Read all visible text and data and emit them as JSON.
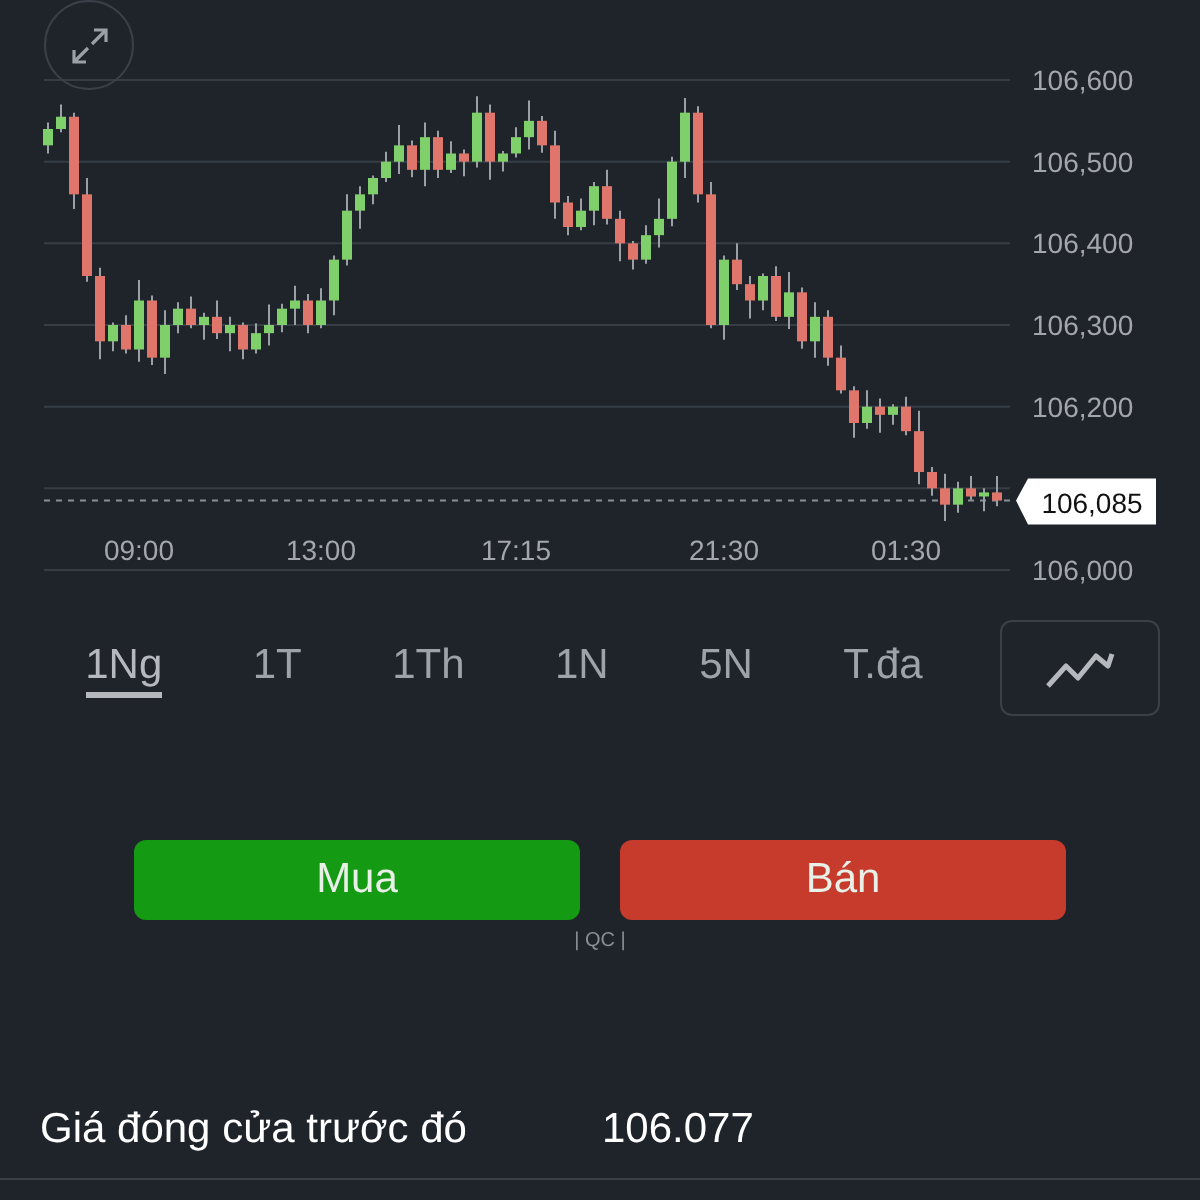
{
  "chart": {
    "chart_data": {
      "type": "candlestick",
      "categories": [
        null,
        null,
        null,
        null,
        null,
        null,
        null,
        "09:00",
        null,
        null,
        null,
        null,
        null,
        null,
        null,
        null,
        null,
        null,
        null,
        null,
        null,
        "13:00",
        null,
        null,
        null,
        null,
        null,
        null,
        null,
        null,
        null,
        null,
        null,
        null,
        null,
        null,
        "17:15",
        null,
        null,
        null,
        null,
        null,
        null,
        null,
        null,
        null,
        null,
        null,
        null,
        null,
        null,
        null,
        "21:30",
        null,
        null,
        null,
        null,
        null,
        null,
        null,
        null,
        null,
        null,
        null,
        null,
        null,
        "01:30",
        null,
        null,
        null,
        null,
        null,
        null,
        null
      ],
      "ohlc": [
        [
          106520,
          106548,
          106510,
          106540
        ],
        [
          106540,
          106570,
          106536,
          106555
        ],
        [
          106555,
          106560,
          106442,
          106460
        ],
        [
          106460,
          106480,
          106353,
          106360
        ],
        [
          106360,
          106370,
          106258,
          106280
        ],
        [
          106280,
          106303,
          106268,
          106300
        ],
        [
          106300,
          106312,
          106265,
          106270
        ],
        [
          106270,
          106355,
          106255,
          106330
        ],
        [
          106330,
          106336,
          106251,
          106260
        ],
        [
          106260,
          106318,
          106240,
          106300
        ],
        [
          106300,
          106328,
          106290,
          106320
        ],
        [
          106320,
          106335,
          106296,
          106300
        ],
        [
          106300,
          106315,
          106282,
          106310
        ],
        [
          106310,
          106330,
          106283,
          106290
        ],
        [
          106290,
          106310,
          106268,
          106300
        ],
        [
          106300,
          106303,
          106258,
          106270
        ],
        [
          106270,
          106302,
          106265,
          106290
        ],
        [
          106290,
          106325,
          106275,
          106300
        ],
        [
          106300,
          106326,
          106291,
          106320
        ],
        [
          106320,
          106348,
          106300,
          106330
        ],
        [
          106330,
          106338,
          106290,
          106300
        ],
        [
          106300,
          106345,
          106296,
          106330
        ],
        [
          106330,
          106385,
          106312,
          106380
        ],
        [
          106380,
          106460,
          106373,
          106440
        ],
        [
          106440,
          106470,
          106418,
          106460
        ],
        [
          106460,
          106483,
          106448,
          106480
        ],
        [
          106480,
          106512,
          106475,
          106500
        ],
        [
          106500,
          106545,
          106485,
          106520
        ],
        [
          106520,
          106526,
          106481,
          106490
        ],
        [
          106490,
          106548,
          106470,
          106530
        ],
        [
          106530,
          106538,
          106480,
          106490
        ],
        [
          106490,
          106525,
          106486,
          106510
        ],
        [
          106510,
          106515,
          106482,
          106500
        ],
        [
          106500,
          106580,
          106493,
          106560
        ],
        [
          106560,
          106570,
          106478,
          106500
        ],
        [
          106500,
          106513,
          106488,
          106510
        ],
        [
          106510,
          106542,
          106505,
          106530
        ],
        [
          106530,
          106575,
          106515,
          106550
        ],
        [
          106550,
          106556,
          106511,
          106520
        ],
        [
          106520,
          106538,
          106430,
          106450
        ],
        [
          106450,
          106458,
          106410,
          106420
        ],
        [
          106420,
          106455,
          106416,
          106440
        ],
        [
          106440,
          106475,
          106422,
          106470
        ],
        [
          106470,
          106490,
          106423,
          106430
        ],
        [
          106430,
          106440,
          106378,
          106400
        ],
        [
          106400,
          106403,
          106368,
          106380
        ],
        [
          106380,
          106422,
          106375,
          106410
        ],
        [
          106410,
          106455,
          106395,
          106430
        ],
        [
          106430,
          106506,
          106421,
          106500
        ],
        [
          106500,
          106578,
          106480,
          106560
        ],
        [
          106560,
          106568,
          106450,
          106460
        ],
        [
          106460,
          106475,
          106296,
          106300
        ],
        [
          106300,
          106385,
          106282,
          106380
        ],
        [
          106380,
          106400,
          106343,
          106350
        ],
        [
          106350,
          106360,
          106308,
          106330
        ],
        [
          106330,
          106363,
          106318,
          106360
        ],
        [
          106360,
          106372,
          106305,
          106310
        ],
        [
          106310,
          106365,
          106295,
          106340
        ],
        [
          106340,
          106346,
          106271,
          106280
        ],
        [
          106280,
          106328,
          106260,
          106310
        ],
        [
          106310,
          106318,
          106250,
          106260
        ],
        [
          106260,
          106275,
          106216,
          106220
        ],
        [
          106220,
          106225,
          106162,
          106180
        ],
        [
          106180,
          106220,
          106173,
          106200
        ],
        [
          106200,
          106210,
          106168,
          106190
        ],
        [
          106190,
          106203,
          106178,
          106200
        ],
        [
          106200,
          106212,
          106165,
          106170
        ],
        [
          106170,
          106195,
          106105,
          106120
        ],
        [
          106120,
          106126,
          106091,
          106100
        ],
        [
          106100,
          106118,
          106060,
          106080
        ],
        [
          106080,
          106108,
          106070,
          106100
        ],
        [
          106100,
          106115,
          106086,
          106090
        ],
        [
          106090,
          106100,
          106072,
          106095
        ],
        [
          106095,
          106115,
          106078,
          106085
        ]
      ],
      "ylim": [
        106000,
        106600
      ],
      "yticks": [
        {
          "value": 106600,
          "label": "106,600"
        },
        {
          "value": 106500,
          "label": "106,500"
        },
        {
          "value": 106400,
          "label": "106,400"
        },
        {
          "value": 106300,
          "label": "106,300"
        },
        {
          "value": 106200,
          "label": "106,200"
        },
        {
          "value": 106000,
          "label": "106,000"
        }
      ],
      "grid": true,
      "ref_lines": [
        {
          "axis": "y",
          "value": 106085,
          "label": "106,085"
        }
      ]
    }
  },
  "timeframes": [
    {
      "label": "1Ng",
      "selected": true
    },
    {
      "label": "1T",
      "selected": false
    },
    {
      "label": "1Th",
      "selected": false
    },
    {
      "label": "1N",
      "selected": false
    },
    {
      "label": "5N",
      "selected": false
    },
    {
      "label": "T.đa",
      "selected": false
    }
  ],
  "actions": [
    {
      "label": "Mua",
      "kind": "buy"
    },
    {
      "label": "Bán",
      "kind": "sell"
    }
  ],
  "ad_label": "| QC |",
  "stats": [
    {
      "label": "Giá đóng cửa trước đó",
      "value": "106.077"
    }
  ]
}
